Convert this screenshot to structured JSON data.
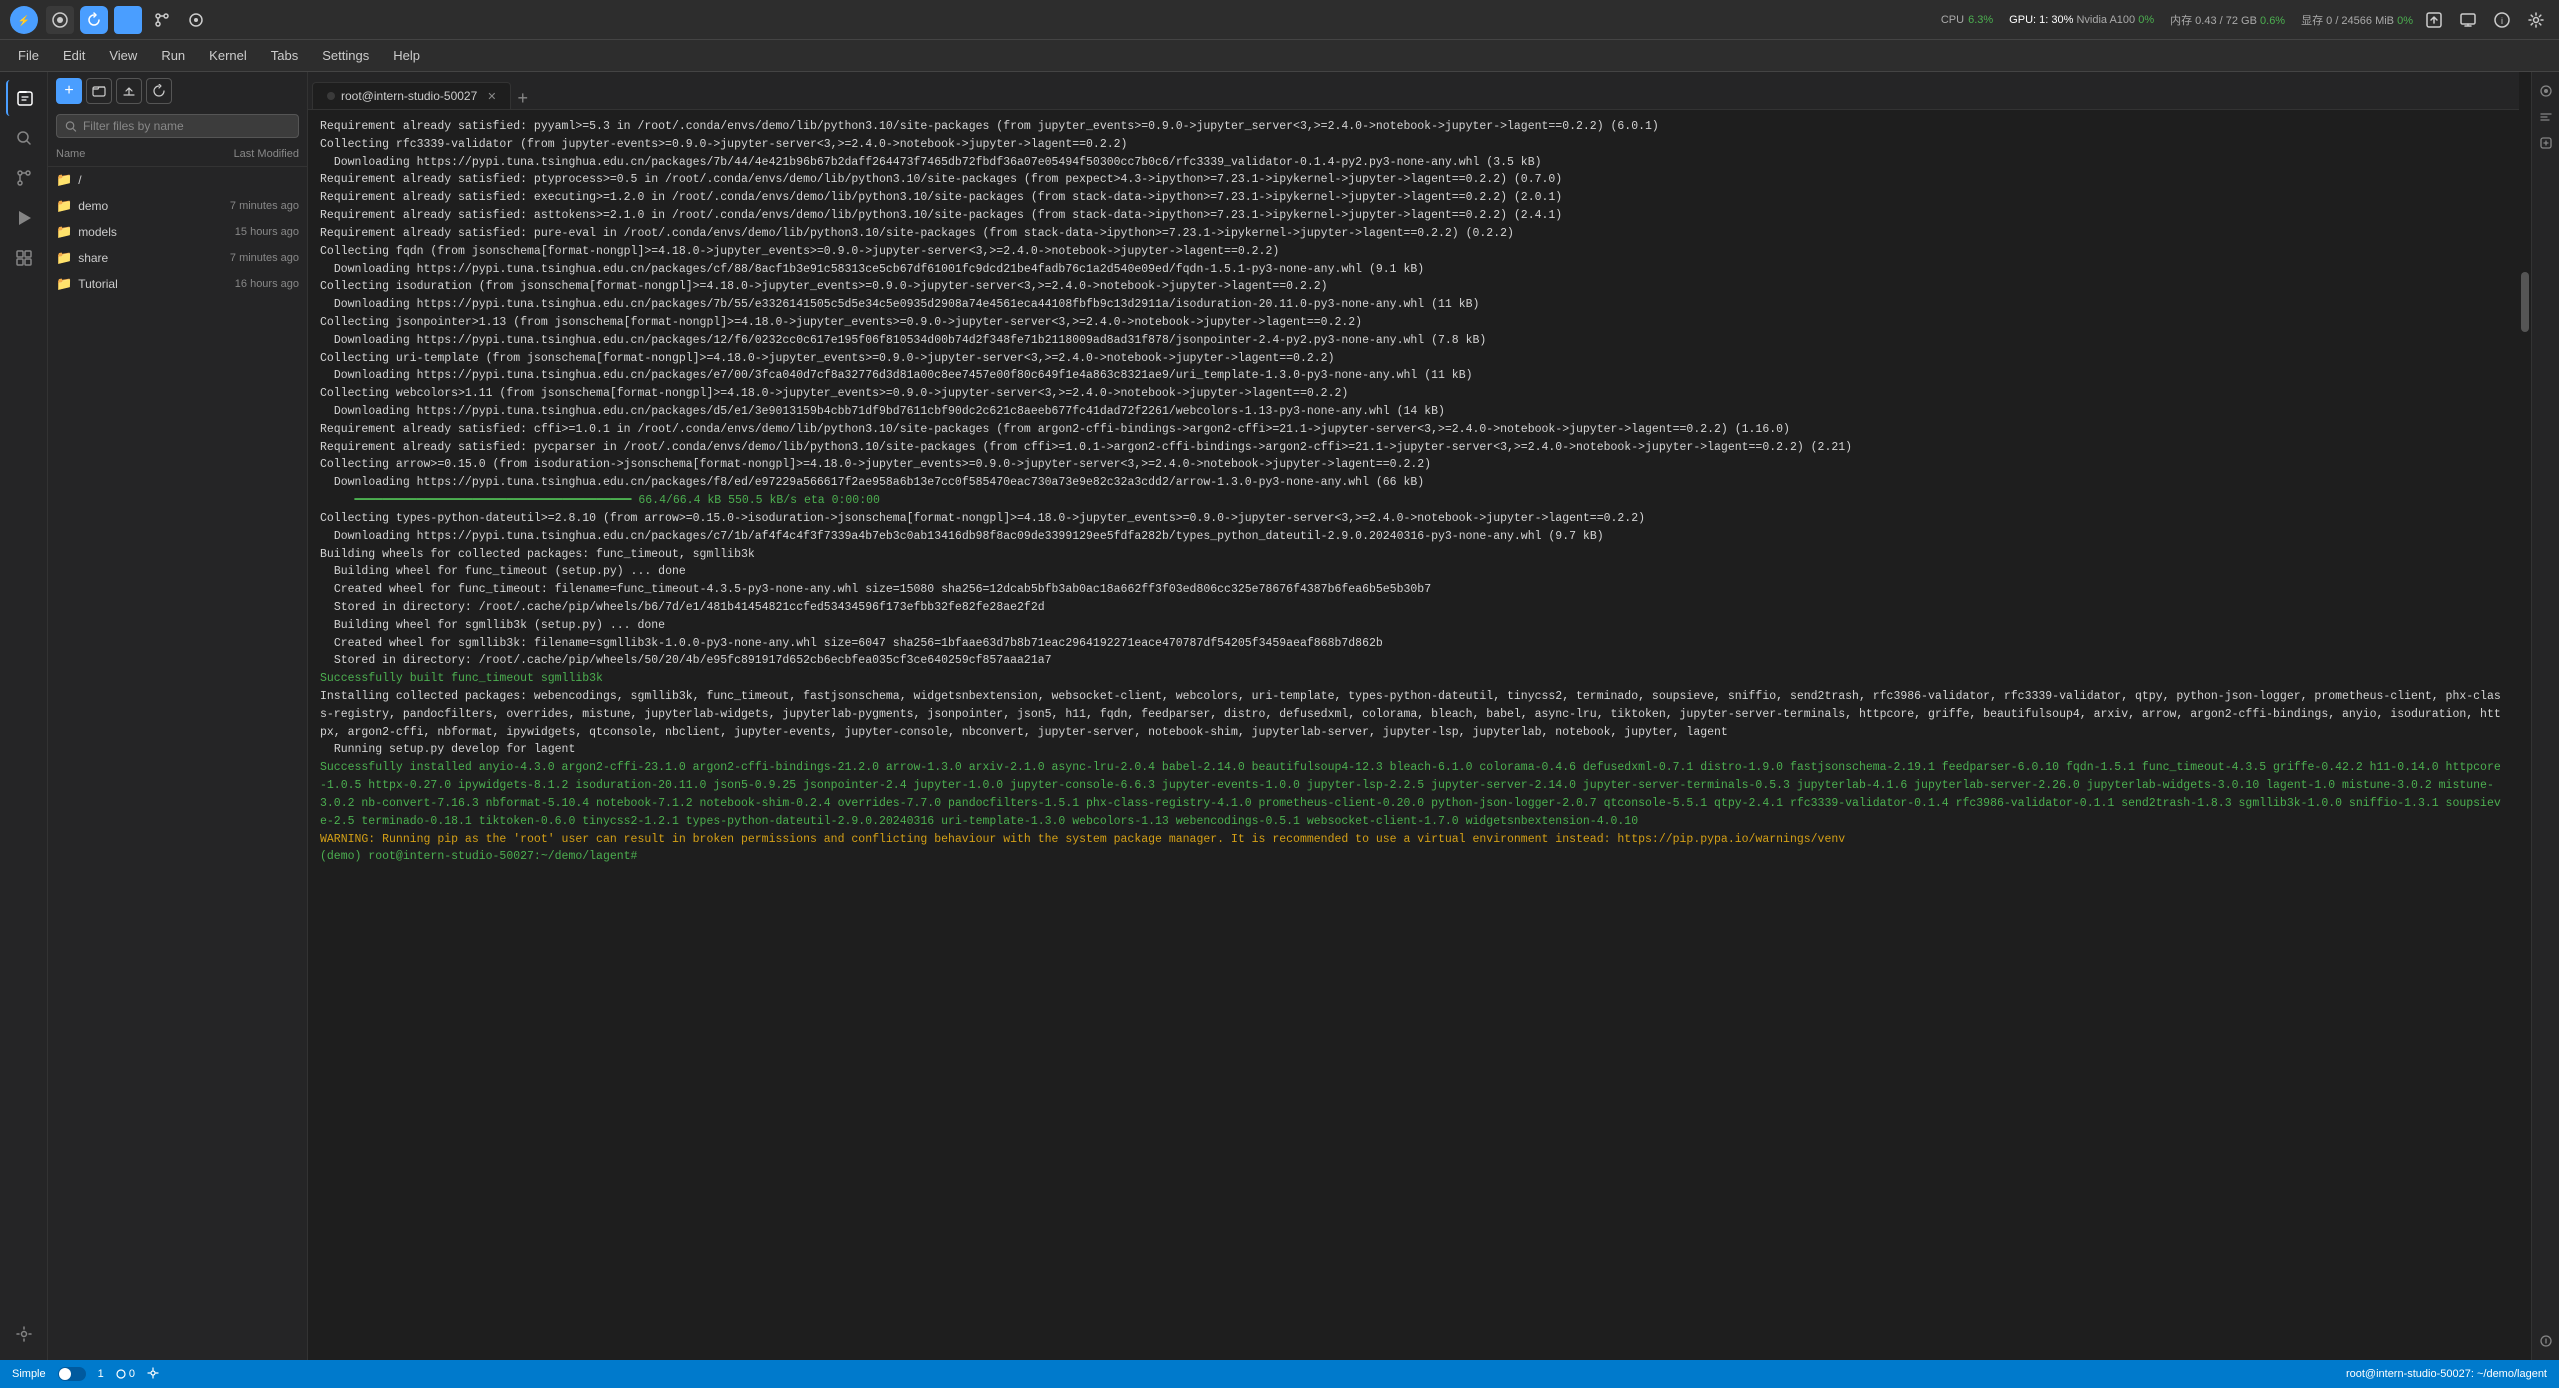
{
  "topbar": {
    "logo": "●",
    "icons": [
      {
        "name": "circle-icon",
        "symbol": "●",
        "active": true
      },
      {
        "name": "refresh-icon",
        "symbol": "↻",
        "active": false
      },
      {
        "name": "code-icon",
        "symbol": "</>",
        "active": true
      },
      {
        "name": "git-icon",
        "symbol": "⎇",
        "active": false
      },
      {
        "name": "target-icon",
        "symbol": "◎",
        "active": false
      }
    ],
    "cpu_label": "CPU",
    "cpu_value": "6.3%",
    "gpu_label": "GPU: 1: 30%",
    "gpu_card": "Nvidia A100",
    "gpu_pct": "0%",
    "mem_label": "内存 0.43 / 72 GB",
    "mem_pct": "0.6%",
    "disk_label": "显存 0 / 24566 MiB",
    "disk_pct": "0%"
  },
  "menubar": {
    "items": [
      "File",
      "Edit",
      "View",
      "Run",
      "Kernel",
      "Tabs",
      "Settings",
      "Help"
    ]
  },
  "file_panel": {
    "search_placeholder": "Filter files by name",
    "col_name": "Name",
    "col_modified": "Last Modified",
    "files": [
      {
        "icon": "📁",
        "name": "/",
        "modified": ""
      },
      {
        "icon": "📁",
        "name": "demo",
        "modified": "7 minutes ago"
      },
      {
        "icon": "📁",
        "name": "models",
        "modified": "15 hours ago"
      },
      {
        "icon": "📁",
        "name": "share",
        "modified": "7 minutes ago"
      },
      {
        "icon": "📁",
        "name": "Tutorial",
        "modified": "16 hours ago"
      }
    ]
  },
  "tabs": [
    {
      "label": "root@intern-studio-50027",
      "has_close": true,
      "active": true
    }
  ],
  "tab_plus": "+",
  "terminal": {
    "lines": [
      {
        "text": "Requirement already satisfied: pyyaml>=5.3 in /root/.conda/envs/demo/lib/python3.10/site-packages (from jupyter_events>=0.9.0->jupyter_server<3,>=2.4.0->notebook->jupyter->lagent==0.2.2) (6.0.1)",
        "class": ""
      },
      {
        "text": "Collecting rfc3339-validator (from jupyter-events>=0.9.0->jupyter-server<3,>=2.4.0->notebook->jupyter->lagent==0.2.2)",
        "class": ""
      },
      {
        "text": "  Downloading https://pypi.tuna.tsinghua.edu.cn/packages/7b/44/4e421b96b67b2daff264473f7465db72fbdf36a07e05494f50300cc7b0c6/rfc3339_validator-0.1.4-py2.py3-none-any.whl (3.5 kB)",
        "class": ""
      },
      {
        "text": "Requirement already satisfied: ptyprocess>=0.5 in /root/.conda/envs/demo/lib/python3.10/site-packages (from pexpect>4.3->ipython>=7.23.1->ipykernel->jupyter->lagent==0.2.2) (0.7.0)",
        "class": ""
      },
      {
        "text": "Requirement already satisfied: executing>=1.2.0 in /root/.conda/envs/demo/lib/python3.10/site-packages (from stack-data->ipython>=7.23.1->ipykernel->jupyter->lagent==0.2.2) (2.0.1)",
        "class": ""
      },
      {
        "text": "Requirement already satisfied: asttokens>=2.1.0 in /root/.conda/envs/demo/lib/python3.10/site-packages (from stack-data->ipython>=7.23.1->ipykernel->jupyter->lagent==0.2.2) (2.4.1)",
        "class": ""
      },
      {
        "text": "Requirement already satisfied: pure-eval in /root/.conda/envs/demo/lib/python3.10/site-packages (from stack-data->ipython>=7.23.1->ipykernel->jupyter->lagent==0.2.2) (0.2.2)",
        "class": ""
      },
      {
        "text": "Collecting fqdn (from jsonschema[format-nongpl]>=4.18.0->jupyter_events>=0.9.0->jupyter-server<3,>=2.4.0->notebook->jupyter->lagent==0.2.2)",
        "class": ""
      },
      {
        "text": "  Downloading https://pypi.tuna.tsinghua.edu.cn/packages/cf/88/8acf1b3e91c58313ce5cb67df61001fc9dcd21be4fadb76c1a2d540e09ed/fqdn-1.5.1-py3-none-any.whl (9.1 kB)",
        "class": ""
      },
      {
        "text": "Collecting isoduration (from jsonschema[format-nongpl]>=4.18.0->jupyter_events>=0.9.0->jupyter-server<3,>=2.4.0->notebook->jupyter->lagent==0.2.2)",
        "class": ""
      },
      {
        "text": "  Downloading https://pypi.tuna.tsinghua.edu.cn/packages/7b/55/e3326141505c5d5e34c5e0935d2908a74e4561eca44108fbfb9c13d2911a/isoduration-20.11.0-py3-none-any.whl (11 kB)",
        "class": ""
      },
      {
        "text": "Collecting jsonpointer>1.13 (from jsonschema[format-nongpl]>=4.18.0->jupyter_events>=0.9.0->jupyter-server<3,>=2.4.0->notebook->jupyter->lagent==0.2.2)",
        "class": ""
      },
      {
        "text": "  Downloading https://pypi.tuna.tsinghua.edu.cn/packages/12/f6/0232cc0c617e195f06f810534d00b74d2f348fe71b2118009ad8ad31f878/jsonpointer-2.4-py2.py3-none-any.whl (7.8 kB)",
        "class": ""
      },
      {
        "text": "Collecting uri-template (from jsonschema[format-nongpl]>=4.18.0->jupyter_events>=0.9.0->jupyter-server<3,>=2.4.0->notebook->jupyter->lagent==0.2.2)",
        "class": ""
      },
      {
        "text": "  Downloading https://pypi.tuna.tsinghua.edu.cn/packages/e7/00/3fca040d7cf8a32776d3d81a00c8ee7457e00f80c649f1e4a863c8321ae9/uri_template-1.3.0-py3-none-any.whl (11 kB)",
        "class": ""
      },
      {
        "text": "Collecting webcolors>1.11 (from jsonschema[format-nongpl]>=4.18.0->jupyter_events>=0.9.0->jupyter-server<3,>=2.4.0->notebook->jupyter->lagent==0.2.2)",
        "class": ""
      },
      {
        "text": "  Downloading https://pypi.tuna.tsinghua.edu.cn/packages/d5/e1/3e9013159b4cbb71df9bd7611cbf90dc2c621c8aeeb677fc41dad72f2261/webcolors-1.13-py3-none-any.whl (14 kB)",
        "class": ""
      },
      {
        "text": "Requirement already satisfied: cffi>=1.0.1 in /root/.conda/envs/demo/lib/python3.10/site-packages (from argon2-cffi-bindings->argon2-cffi>=21.1->jupyter-server<3,>=2.4.0->notebook->jupyter->lagent==0.2.2) (1.16.0)",
        "class": ""
      },
      {
        "text": "Requirement already satisfied: pycparser in /root/.conda/envs/demo/lib/python3.10/site-packages (from cffi>=1.0.1->argon2-cffi-bindings->argon2-cffi>=21.1->jupyter-server<3,>=2.4.0->notebook->jupyter->lagent==0.2.2) (2.21)",
        "class": ""
      },
      {
        "text": "Collecting arrow>=0.15.0 (from isoduration->jsonschema[format-nongpl]>=4.18.0->jupyter_events>=0.9.0->jupyter-server<3,>=2.4.0->notebook->jupyter->lagent==0.2.2)",
        "class": ""
      },
      {
        "text": "  Downloading https://pypi.tuna.tsinghua.edu.cn/packages/f8/ed/e97229a566617f2ae958a6b13e7cc0f585470eac730a73e9e82c32a3cdd2/arrow-1.3.0-py3-none-any.whl (66 kB)",
        "class": ""
      },
      {
        "text": "     ━━━━━━━━━━━━━━━━━━━━━━━━━━━━━━━━━━━━━━━━ 66.4/66.4 kB 550.5 kB/s eta 0:00:00",
        "class": "progress"
      },
      {
        "text": "Collecting types-python-dateutil>=2.8.10 (from arrow>=0.15.0->isoduration->jsonschema[format-nongpl]>=4.18.0->jupyter_events>=0.9.0->jupyter-server<3,>=2.4.0->notebook->jupyter->lagent==0.2.2)",
        "class": ""
      },
      {
        "text": "  Downloading https://pypi.tuna.tsinghua.edu.cn/packages/c7/1b/af4f4c4f3f7339a4b7eb3c0ab13416db98f8ac09de3399129ee5fdfa282b/types_python_dateutil-2.9.0.20240316-py3-none-any.whl (9.7 kB)",
        "class": ""
      },
      {
        "text": "Building wheels for collected packages: func_timeout, sgmllib3k",
        "class": ""
      },
      {
        "text": "  Building wheel for func_timeout (setup.py) ... done",
        "class": ""
      },
      {
        "text": "  Created wheel for func_timeout: filename=func_timeout-4.3.5-py3-none-any.whl size=15080 sha256=12dcab5bfb3ab0ac18a662ff3f03ed806cc325e78676f4387b6fea6b5e5b30b7",
        "class": ""
      },
      {
        "text": "  Stored in directory: /root/.cache/pip/wheels/b6/7d/e1/481b41454821ccfed53434596f173efbb32fe82fe28ae2f2d",
        "class": ""
      },
      {
        "text": "  Building wheel for sgmllib3k (setup.py) ... done",
        "class": ""
      },
      {
        "text": "  Created wheel for sgmllib3k: filename=sgmllib3k-1.0.0-py3-none-any.whl size=6047 sha256=1bfaae63d7b8b71eac2964192271eace470787df54205f3459aeaf868b7d862b",
        "class": ""
      },
      {
        "text": "  Stored in directory: /root/.cache/pip/wheels/50/20/4b/e95fc891917d652cb6ecbfea035cf3ce640259cf857aaa21a7",
        "class": ""
      },
      {
        "text": "Successfully built func_timeout sgmllib3k",
        "class": "green"
      },
      {
        "text": "Installing collected packages: webencodings, sgmllib3k, func_timeout, fastjsonschema, widgetsnbextension, websocket-client, webcolors, uri-template, types-python-dateutil, tinycss2, terminado, soupsieve, sniffio, send2trash, rfc3986-validator, rfc3339-validator, qtpy, python-json-logger, prometheus-client, phx-class-registry, pandocfilters, overrides, mistune, jupyterlab-widgets, jupyterlab-pygments, jsonpointer, json5, h11, fqdn, feedparser, distro, defusedxml, colorama, bleach, babel, async-lru, tiktoken, jupyter-server-terminals, httpcore, griffe, beautifulsoup4, arxiv, arrow, argon2-cffi-bindings, anyio, isoduration, httpx, argon2-cffi, nbformat, ipywidgets, qtconsole, nbclient, jupyter-events, jupyter-console, nbconvert, jupyter-server, notebook-shim, jupyterlab-server, jupyter-lsp, jupyterlab, notebook, jupyter, lagent",
        "class": ""
      },
      {
        "text": "  Running setup.py develop for lagent",
        "class": ""
      },
      {
        "text": "Successfully installed anyio-4.3.0 argon2-cffi-23.1.0 argon2-cffi-bindings-21.2.0 arrow-1.3.0 arxiv-2.1.0 async-lru-2.0.4 babel-2.14.0 beautifulsoup4-12.3 bleach-6.1.0 colorama-0.4.6 defusedxml-0.7.1 distro-1.9.0 fastjsonschema-2.19.1 feedparser-6.0.10 fqdn-1.5.1 func_timeout-4.3.5 griffe-0.42.2 h11-0.14.0 httpcore-1.0.5 httpx-0.27.0 ipywidgets-8.1.2 isoduration-20.11.0 json5-0.9.25 jsonpointer-2.4 jupyter-1.0.0 jupyter-console-6.6.3 jupyter-events-1.0.0 jupyter-lsp-2.2.5 jupyter-server-2.14.0 jupyter-server-terminals-0.5.3 jupyterlab-4.1.6 jupyterlab-server-2.26.0 jupyterlab-widgets-3.0.10 lagent-1.0 mistune-3.0.2 mistune-3.0.2 nb-convert-7.16.3 nbformat-5.10.4 notebook-7.1.2 notebook-shim-0.2.4 overrides-7.7.0 pandocfilters-1.5.1 phx-class-registry-4.1.0 prometheus-client-0.20.0 python-json-logger-2.0.7 qtconsole-5.5.1 qtpy-2.4.1 rfc3339-validator-0.1.4 rfc3986-validator-0.1.1 send2trash-1.8.3 sgmllib3k-1.0.0 sniffio-1.3.1 soupsieve-2.5 terminado-0.18.1 tiktoken-0.6.0 tinycss2-1.2.1 types-python-dateutil-2.9.0.20240316 uri-template-1.3.0 webcolors-1.13 webencodings-0.5.1 websocket-client-1.7.0 widgetsnbextension-4.0.10",
        "class": "green"
      },
      {
        "text": "WARNING: Running pip as the 'root' user can result in broken permissions and conflicting behaviour with the system package manager. It is recommended to use a virtual environment instead: https://pip.pypa.io/warnings/venv",
        "class": "yellow"
      },
      {
        "text": "(demo) root@intern-studio-50027:~/demo/lagent# ",
        "class": "prompt"
      }
    ]
  },
  "bottom_bar": {
    "simple_label": "Simple",
    "toggle_state": "off",
    "line_number": "1",
    "col_number": "0",
    "status_right": "root@intern-studio-50027: ~/demo/lagent"
  }
}
